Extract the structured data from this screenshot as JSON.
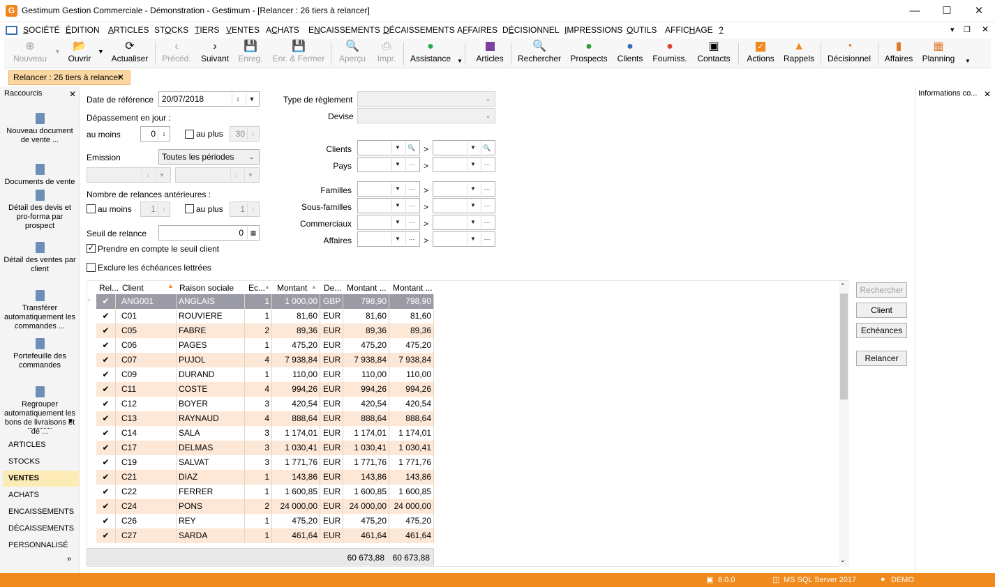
{
  "window": {
    "title": "Gestimum Gestion Commerciale - Démonstration - Gestimum - [Relancer : 26 tiers à relancer]",
    "logo": "G"
  },
  "menu": [
    {
      "pre": "",
      "u": "S",
      "post": "OCIÉTÉ"
    },
    {
      "pre": "",
      "u": "É",
      "post": "DITION"
    },
    {
      "pre": "",
      "u": "A",
      "post": "RTICLES"
    },
    {
      "pre": "ST",
      "u": "O",
      "post": "CKS"
    },
    {
      "pre": "",
      "u": "T",
      "post": "IERS"
    },
    {
      "pre": "",
      "u": "V",
      "post": "ENTES"
    },
    {
      "pre": "A",
      "u": "C",
      "post": "HATS"
    },
    {
      "pre": "E",
      "u": "N",
      "post": "CAISSEMENTS"
    },
    {
      "pre": "",
      "u": "D",
      "post": "ÉCAISSEMENTS"
    },
    {
      "pre": "A",
      "u": "F",
      "post": "FAIRES"
    },
    {
      "pre": "D",
      "u": "É",
      "post": "CISIONNEL"
    },
    {
      "pre": "",
      "u": "I",
      "post": "MPRESSIONS"
    },
    {
      "pre": "",
      "u": "O",
      "post": "UTILS"
    },
    {
      "pre": "AFFIC",
      "u": "H",
      "post": "AGE"
    },
    {
      "pre": "",
      "u": "?",
      "post": ""
    }
  ],
  "toolbar": {
    "nouveau": "Nouveau",
    "ouvrir": "Ouvrir",
    "actualiser": "Actualiser",
    "preced": "Précéd.",
    "suivant": "Suivant",
    "enreg": "Enreg.",
    "enreg_fermer": "Enr. & Fermer",
    "apercu": "Aperçu",
    "impr": "Impr.",
    "assistance": "Assistance",
    "articles": "Articles",
    "rechercher": "Rechercher",
    "prospects": "Prospects",
    "clients": "Clients",
    "fourniss": "Fourniss.",
    "contacts": "Contacts",
    "actions": "Actions",
    "rappels": "Rappels",
    "decisionnel": "Décisionnel",
    "affaires": "Affaires",
    "planning": "Planning"
  },
  "doc_tab": {
    "label": "Relancer : 26 tiers à relancer",
    "close": "✕"
  },
  "sidebar": {
    "title": "Raccourcis",
    "close": "✕",
    "shortcuts": [
      "Nouveau document de vente ...",
      "Documents de vente",
      "Détail des devis et pro-forma par prospect",
      "Détail des ventes par client",
      "Transférer automatiquement les commandes ...",
      "Portefeuille des commandes",
      "Regrouper automatiquement les bons de livraisons et de ..."
    ],
    "nav": [
      "ARTICLES",
      "STOCKS",
      "VENTES",
      "ACHATS",
      "ENCAISSEMENTS",
      "DÉCAISSEMENTS",
      "PERSONNALISÉ"
    ],
    "active_nav": "VENTES"
  },
  "form": {
    "date_ref_label": "Date de référence",
    "date_ref": "20/07/2018",
    "depassement_label": "Dépassement en jour :",
    "au_moins": "au moins",
    "au_moins_val": "0",
    "au_plus": "au plus",
    "au_plus_val": "30",
    "emission_label": "Emission",
    "emission_val": "Toutes les périodes",
    "nb_relances_label": "Nombre de relances antérieures :",
    "nb_au_moins": "au moins",
    "nb_au_moins_val": "1",
    "nb_au_plus": "au plus",
    "nb_au_plus_val": "1",
    "seuil_label": "Seuil de relance",
    "seuil_val": "0",
    "prendre_seuil": "Prendre en compte le seuil client",
    "exclure": "Exclure les échéances lettrées",
    "type_reglement": "Type de règlement",
    "devise": "Devise",
    "clients": "Clients",
    "pays": "Pays",
    "familles": "Familles",
    "sous_familles": "Sous-familles",
    "commerciaux": "Commerciaux",
    "affaires": "Affaires",
    "gt": ">"
  },
  "grid": {
    "columns": [
      "Rel...",
      "Client",
      "Raison sociale",
      "Ec...",
      "Montant",
      "De...",
      "Montant ...",
      "Montant ..."
    ],
    "rows": [
      [
        "✔",
        "ANG001",
        "ANGLAIS",
        "1",
        "1 000,00",
        "GBP",
        "798,90",
        "798,90"
      ],
      [
        "✔",
        "C01",
        "ROUVIERE",
        "1",
        "81,60",
        "EUR",
        "81,60",
        "81,60"
      ],
      [
        "✔",
        "C05",
        "FABRE",
        "2",
        "89,36",
        "EUR",
        "89,36",
        "89,36"
      ],
      [
        "✔",
        "C06",
        "PAGES",
        "1",
        "475,20",
        "EUR",
        "475,20",
        "475,20"
      ],
      [
        "✔",
        "C07",
        "PUJOL",
        "4",
        "7 938,84",
        "EUR",
        "7 938,84",
        "7 938,84"
      ],
      [
        "✔",
        "C09",
        "DURAND",
        "1",
        "110,00",
        "EUR",
        "110,00",
        "110,00"
      ],
      [
        "✔",
        "C11",
        "COSTE",
        "4",
        "994,26",
        "EUR",
        "994,26",
        "994,26"
      ],
      [
        "✔",
        "C12",
        "BOYER",
        "3",
        "420,54",
        "EUR",
        "420,54",
        "420,54"
      ],
      [
        "✔",
        "C13",
        "RAYNAUD",
        "4",
        "888,64",
        "EUR",
        "888,64",
        "888,64"
      ],
      [
        "✔",
        "C14",
        "SALA",
        "3",
        "1 174,01",
        "EUR",
        "1 174,01",
        "1 174,01"
      ],
      [
        "✔",
        "C17",
        "DELMAS",
        "3",
        "1 030,41",
        "EUR",
        "1 030,41",
        "1 030,41"
      ],
      [
        "✔",
        "C19",
        "SALVAT",
        "3",
        "1 771,76",
        "EUR",
        "1 771,76",
        "1 771,76"
      ],
      [
        "✔",
        "C21",
        "DIAZ",
        "1",
        "143,86",
        "EUR",
        "143,86",
        "143,86"
      ],
      [
        "✔",
        "C22",
        "FERRER",
        "1",
        "1 600,85",
        "EUR",
        "1 600,85",
        "1 600,85"
      ],
      [
        "✔",
        "C24",
        "PONS",
        "2",
        "24 000,00",
        "EUR",
        "24 000,00",
        "24 000,00"
      ],
      [
        "✔",
        "C26",
        "REY",
        "1",
        "475,20",
        "EUR",
        "475,20",
        "475,20"
      ],
      [
        "✔",
        "C27",
        "SARDA",
        "1",
        "461,64",
        "EUR",
        "461,64",
        "461,64"
      ]
    ],
    "totals": [
      "60 673,88",
      "60 673,88"
    ]
  },
  "right_buttons": {
    "rechercher": "Rechercher",
    "client": "Client",
    "echeances": "Echéances",
    "relancer": "Relancer"
  },
  "info_panel": {
    "title": "Informations co...",
    "close": "✕"
  },
  "status": {
    "version": "8.0.0",
    "server": "MS SQL Server 2017",
    "user": "DEMO"
  },
  "colors": {
    "accent": "#f08a1d",
    "row_alt": "#fde8d7",
    "selected_row": "#9b9ba6",
    "active_nav": "#fcebb4"
  }
}
